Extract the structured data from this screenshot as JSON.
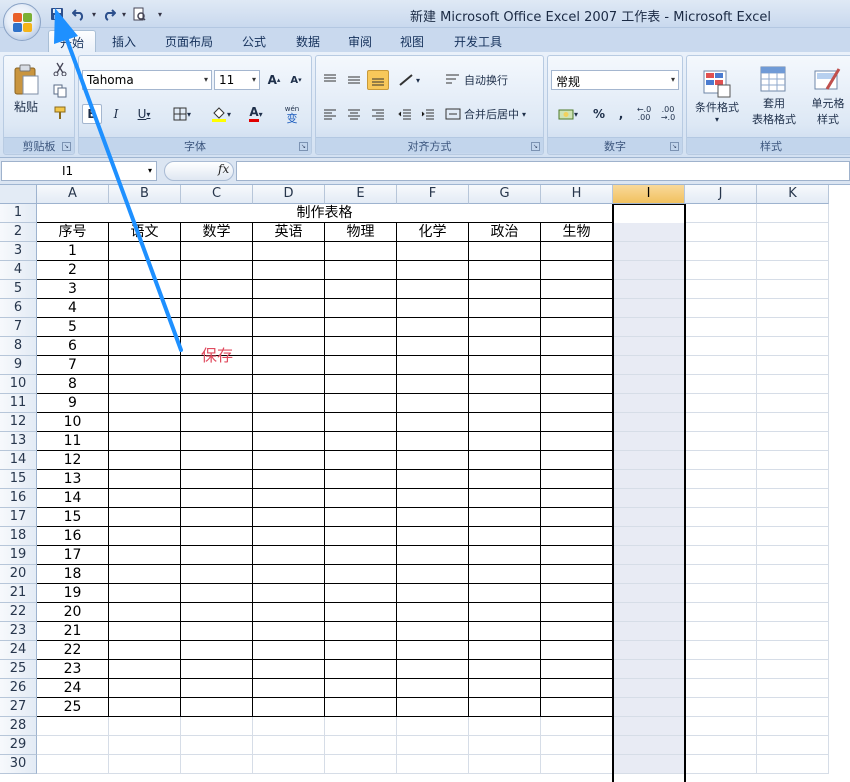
{
  "window": {
    "title": "新建 Microsoft Office Excel 2007 工作表 - Microsoft Excel"
  },
  "tabs": [
    {
      "label": "开始"
    },
    {
      "label": "插入"
    },
    {
      "label": "页面布局"
    },
    {
      "label": "公式"
    },
    {
      "label": "数据"
    },
    {
      "label": "审阅"
    },
    {
      "label": "视图"
    },
    {
      "label": "开发工具"
    }
  ],
  "ribbon": {
    "clipboard": {
      "label": "剪贴板",
      "paste": "粘贴"
    },
    "font": {
      "label": "字体",
      "name": "Tahoma",
      "size": "11",
      "wen": "wén",
      "bian": "变"
    },
    "alignment": {
      "label": "对齐方式",
      "wrap": "自动换行",
      "merge": "合并后居中"
    },
    "number": {
      "label": "数字",
      "format": "常规",
      "percent": "%",
      "comma": ","
    },
    "styles": {
      "label": "样式",
      "conditional": "条件格式",
      "table1": "套用",
      "table2": "表格格式",
      "cell1": "单元格",
      "cell2": "样式"
    }
  },
  "formula_bar": {
    "name_box": "I1",
    "fx": "fx",
    "formula": ""
  },
  "columns": [
    "A",
    "B",
    "C",
    "D",
    "E",
    "F",
    "G",
    "H",
    "I",
    "J",
    "K"
  ],
  "selected_column": "I",
  "rows": [
    "1",
    "2",
    "3",
    "4",
    "5",
    "6",
    "7",
    "8",
    "9",
    "10",
    "11",
    "12",
    "13",
    "14",
    "15",
    "16",
    "17",
    "18",
    "19",
    "20",
    "21",
    "22",
    "23",
    "24",
    "25",
    "26",
    "27",
    "28",
    "29",
    "30"
  ],
  "table": {
    "title": "制作表格",
    "headers": [
      "序号",
      "语文",
      "数学",
      "英语",
      "物理",
      "化学",
      "政治",
      "生物"
    ],
    "serials": [
      "1",
      "2",
      "3",
      "4",
      "5",
      "6",
      "7",
      "8",
      "9",
      "10",
      "11",
      "12",
      "13",
      "14",
      "15",
      "16",
      "17",
      "18",
      "19",
      "20",
      "21",
      "22",
      "23",
      "24",
      "25"
    ]
  },
  "annotation": {
    "text": "保存",
    "color": "#e04b5f",
    "arrow_color": "#1e90ff"
  },
  "colors": {
    "selection_header": "#f1c15f",
    "grid": "#d6dde7",
    "ribbon": "#d3e1f2"
  }
}
